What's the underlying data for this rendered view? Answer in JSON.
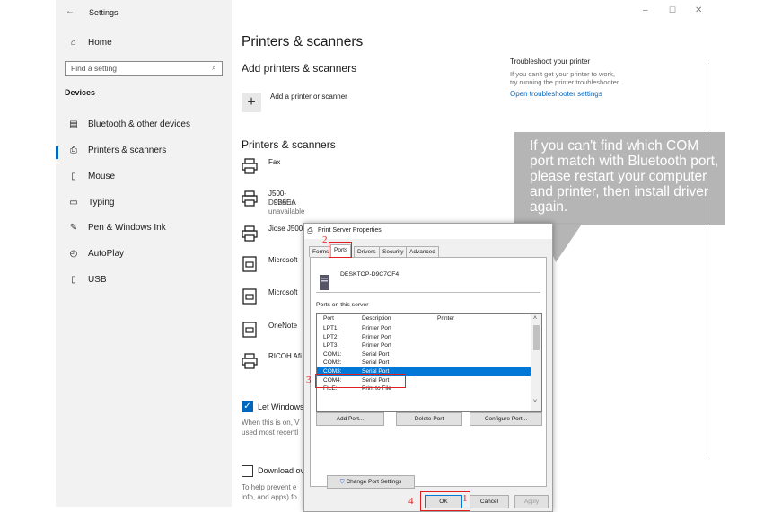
{
  "window": {
    "title": "Settings",
    "controls": [
      "–",
      "☐",
      "✕"
    ],
    "back": "←"
  },
  "sidebar": {
    "home": "Home",
    "search_placeholder": "Find a setting",
    "section": "Devices",
    "items": [
      {
        "label": "Bluetooth & other devices",
        "icon": "bluetooth-icon"
      },
      {
        "label": "Printers & scanners",
        "icon": "printer-icon",
        "selected": true
      },
      {
        "label": "Mouse",
        "icon": "mouse-icon"
      },
      {
        "label": "Typing",
        "icon": "keyboard-icon"
      },
      {
        "label": "Pen & Windows Ink",
        "icon": "pen-icon"
      },
      {
        "label": "AutoPlay",
        "icon": "autoplay-icon"
      },
      {
        "label": "USB",
        "icon": "usb-icon"
      }
    ]
  },
  "main": {
    "title": "Printers & scanners",
    "add_heading": "Add printers & scanners",
    "add_label": "Add a printer or scanner",
    "list_heading": "Printers & scanners",
    "printers": [
      {
        "name": "Fax",
        "status": ""
      },
      {
        "name": "J500-D9B5EA",
        "status": "Driver is unavailable"
      },
      {
        "name": "Jiose J500",
        "status": ""
      },
      {
        "name": "Microsoft",
        "status": ""
      },
      {
        "name": "Microsoft",
        "status": ""
      },
      {
        "name": "OneNote",
        "status": ""
      },
      {
        "name": "RICOH Afi",
        "status": ""
      }
    ],
    "let_windows_label": "Let Windows",
    "let_windows_desc_1": "When this is on, V",
    "let_windows_desc_2": "used most recentl",
    "download_label": "Download ov",
    "download_desc_1": "To help prevent e",
    "download_desc_2": "info, and apps) fo"
  },
  "troubleshoot": {
    "title": "Troubleshoot your printer",
    "line1": "If you can't get your printer to work,",
    "line2": "try running the printer troubleshooter.",
    "link": "Open troubleshooter settings"
  },
  "callout": {
    "text": "If you can't find which COM port match with Bluetooth port, please restart your computer and printer, then install driver again."
  },
  "dialog": {
    "title": "Print Server Properties",
    "tabs": [
      "Forms",
      "Ports",
      "Drivers",
      "Security",
      "Advanced"
    ],
    "server": "DESKTOP-D9C7OF4",
    "ports_label": "Ports on this server",
    "columns": [
      "Port",
      "Description",
      "Printer"
    ],
    "rows": [
      {
        "port": "LPT1:",
        "desc": "Printer Port"
      },
      {
        "port": "LPT2:",
        "desc": "Printer Port"
      },
      {
        "port": "LPT3:",
        "desc": "Printer Port"
      },
      {
        "port": "COM1:",
        "desc": "Serial Port"
      },
      {
        "port": "COM2:",
        "desc": "Serial Port"
      },
      {
        "port": "COM3:",
        "desc": "Serial Port",
        "selected": true
      },
      {
        "port": "COM4:",
        "desc": "Serial Port"
      },
      {
        "port": "FILE:",
        "desc": "Print to File"
      }
    ],
    "add_port": "Add Port...",
    "delete_port": "Delete Port",
    "configure_port": "Configure Port...",
    "change_settings": "Change Port Settings",
    "ok": "OK",
    "cancel": "Cancel",
    "apply": "Apply"
  },
  "steps": [
    "1",
    "2",
    "3",
    "4"
  ],
  "colors": {
    "accent": "#0067c0",
    "highlight": "#0078d7",
    "annotation": "#e02020"
  }
}
